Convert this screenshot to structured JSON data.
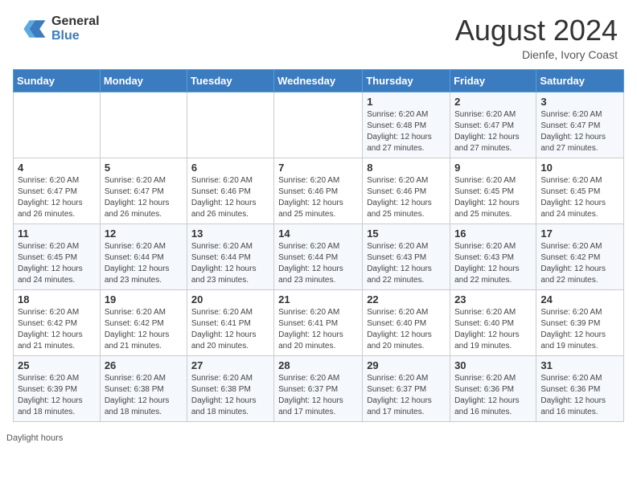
{
  "header": {
    "logo_general": "General",
    "logo_blue": "Blue",
    "month_year": "August 2024",
    "location": "Dienfe, Ivory Coast"
  },
  "weekdays": [
    "Sunday",
    "Monday",
    "Tuesday",
    "Wednesday",
    "Thursday",
    "Friday",
    "Saturday"
  ],
  "footer": {
    "daylight_hours_label": "Daylight hours"
  },
  "weeks": [
    {
      "days": [
        {
          "num": "",
          "info": ""
        },
        {
          "num": "",
          "info": ""
        },
        {
          "num": "",
          "info": ""
        },
        {
          "num": "",
          "info": ""
        },
        {
          "num": "1",
          "info": "Sunrise: 6:20 AM\nSunset: 6:48 PM\nDaylight: 12 hours\nand 27 minutes."
        },
        {
          "num": "2",
          "info": "Sunrise: 6:20 AM\nSunset: 6:47 PM\nDaylight: 12 hours\nand 27 minutes."
        },
        {
          "num": "3",
          "info": "Sunrise: 6:20 AM\nSunset: 6:47 PM\nDaylight: 12 hours\nand 27 minutes."
        }
      ]
    },
    {
      "days": [
        {
          "num": "4",
          "info": "Sunrise: 6:20 AM\nSunset: 6:47 PM\nDaylight: 12 hours\nand 26 minutes."
        },
        {
          "num": "5",
          "info": "Sunrise: 6:20 AM\nSunset: 6:47 PM\nDaylight: 12 hours\nand 26 minutes."
        },
        {
          "num": "6",
          "info": "Sunrise: 6:20 AM\nSunset: 6:46 PM\nDaylight: 12 hours\nand 26 minutes."
        },
        {
          "num": "7",
          "info": "Sunrise: 6:20 AM\nSunset: 6:46 PM\nDaylight: 12 hours\nand 25 minutes."
        },
        {
          "num": "8",
          "info": "Sunrise: 6:20 AM\nSunset: 6:46 PM\nDaylight: 12 hours\nand 25 minutes."
        },
        {
          "num": "9",
          "info": "Sunrise: 6:20 AM\nSunset: 6:45 PM\nDaylight: 12 hours\nand 25 minutes."
        },
        {
          "num": "10",
          "info": "Sunrise: 6:20 AM\nSunset: 6:45 PM\nDaylight: 12 hours\nand 24 minutes."
        }
      ]
    },
    {
      "days": [
        {
          "num": "11",
          "info": "Sunrise: 6:20 AM\nSunset: 6:45 PM\nDaylight: 12 hours\nand 24 minutes."
        },
        {
          "num": "12",
          "info": "Sunrise: 6:20 AM\nSunset: 6:44 PM\nDaylight: 12 hours\nand 23 minutes."
        },
        {
          "num": "13",
          "info": "Sunrise: 6:20 AM\nSunset: 6:44 PM\nDaylight: 12 hours\nand 23 minutes."
        },
        {
          "num": "14",
          "info": "Sunrise: 6:20 AM\nSunset: 6:44 PM\nDaylight: 12 hours\nand 23 minutes."
        },
        {
          "num": "15",
          "info": "Sunrise: 6:20 AM\nSunset: 6:43 PM\nDaylight: 12 hours\nand 22 minutes."
        },
        {
          "num": "16",
          "info": "Sunrise: 6:20 AM\nSunset: 6:43 PM\nDaylight: 12 hours\nand 22 minutes."
        },
        {
          "num": "17",
          "info": "Sunrise: 6:20 AM\nSunset: 6:42 PM\nDaylight: 12 hours\nand 22 minutes."
        }
      ]
    },
    {
      "days": [
        {
          "num": "18",
          "info": "Sunrise: 6:20 AM\nSunset: 6:42 PM\nDaylight: 12 hours\nand 21 minutes."
        },
        {
          "num": "19",
          "info": "Sunrise: 6:20 AM\nSunset: 6:42 PM\nDaylight: 12 hours\nand 21 minutes."
        },
        {
          "num": "20",
          "info": "Sunrise: 6:20 AM\nSunset: 6:41 PM\nDaylight: 12 hours\nand 20 minutes."
        },
        {
          "num": "21",
          "info": "Sunrise: 6:20 AM\nSunset: 6:41 PM\nDaylight: 12 hours\nand 20 minutes."
        },
        {
          "num": "22",
          "info": "Sunrise: 6:20 AM\nSunset: 6:40 PM\nDaylight: 12 hours\nand 20 minutes."
        },
        {
          "num": "23",
          "info": "Sunrise: 6:20 AM\nSunset: 6:40 PM\nDaylight: 12 hours\nand 19 minutes."
        },
        {
          "num": "24",
          "info": "Sunrise: 6:20 AM\nSunset: 6:39 PM\nDaylight: 12 hours\nand 19 minutes."
        }
      ]
    },
    {
      "days": [
        {
          "num": "25",
          "info": "Sunrise: 6:20 AM\nSunset: 6:39 PM\nDaylight: 12 hours\nand 18 minutes."
        },
        {
          "num": "26",
          "info": "Sunrise: 6:20 AM\nSunset: 6:38 PM\nDaylight: 12 hours\nand 18 minutes."
        },
        {
          "num": "27",
          "info": "Sunrise: 6:20 AM\nSunset: 6:38 PM\nDaylight: 12 hours\nand 18 minutes."
        },
        {
          "num": "28",
          "info": "Sunrise: 6:20 AM\nSunset: 6:37 PM\nDaylight: 12 hours\nand 17 minutes."
        },
        {
          "num": "29",
          "info": "Sunrise: 6:20 AM\nSunset: 6:37 PM\nDaylight: 12 hours\nand 17 minutes."
        },
        {
          "num": "30",
          "info": "Sunrise: 6:20 AM\nSunset: 6:36 PM\nDaylight: 12 hours\nand 16 minutes."
        },
        {
          "num": "31",
          "info": "Sunrise: 6:20 AM\nSunset: 6:36 PM\nDaylight: 12 hours\nand 16 minutes."
        }
      ]
    }
  ]
}
